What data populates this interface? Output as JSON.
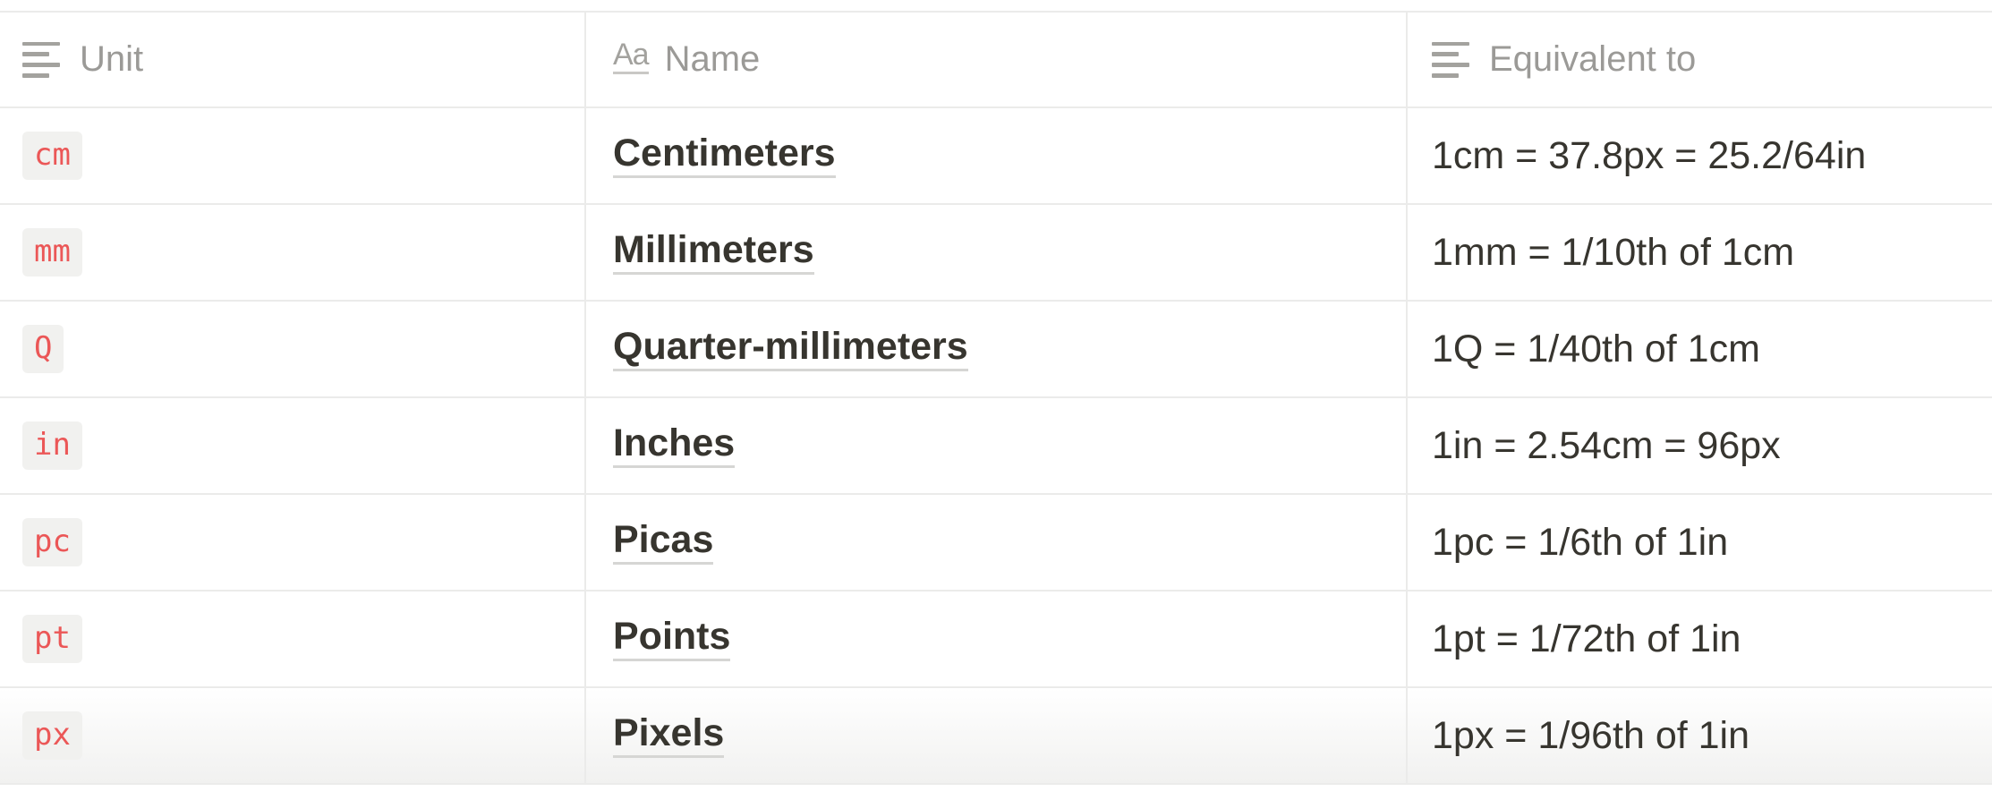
{
  "table": {
    "columns": [
      {
        "label": "Unit",
        "icon": "text-lines-icon"
      },
      {
        "label": "Name",
        "icon": "title-aa-icon"
      },
      {
        "label": "Equivalent to",
        "icon": "text-lines-icon"
      }
    ],
    "title_icon_glyph": "Aa",
    "rows": [
      {
        "unit": "cm",
        "name": "Centimeters",
        "equivalent": "1cm = 37.8px = 25.2/64in"
      },
      {
        "unit": "mm",
        "name": "Millimeters",
        "equivalent": "1mm = 1/10th of 1cm"
      },
      {
        "unit": "Q",
        "name": "Quarter-millimeters",
        "equivalent": "1Q = 1/40th of 1cm"
      },
      {
        "unit": "in",
        "name": "Inches",
        "equivalent": "1in = 2.54cm = 96px"
      },
      {
        "unit": "pc",
        "name": "Picas",
        "equivalent": "1pc = 1/6th of 1in"
      },
      {
        "unit": "pt",
        "name": "Points",
        "equivalent": "1pt = 1/72th of 1in"
      },
      {
        "unit": "px",
        "name": "Pixels",
        "equivalent": "1px = 1/96th of 1in"
      }
    ]
  },
  "colors": {
    "code_text": "#eb5757",
    "code_bg": "#f1f1ef",
    "header_text": "#9b9a97",
    "body_text": "#37352f",
    "border": "#ebebea"
  }
}
